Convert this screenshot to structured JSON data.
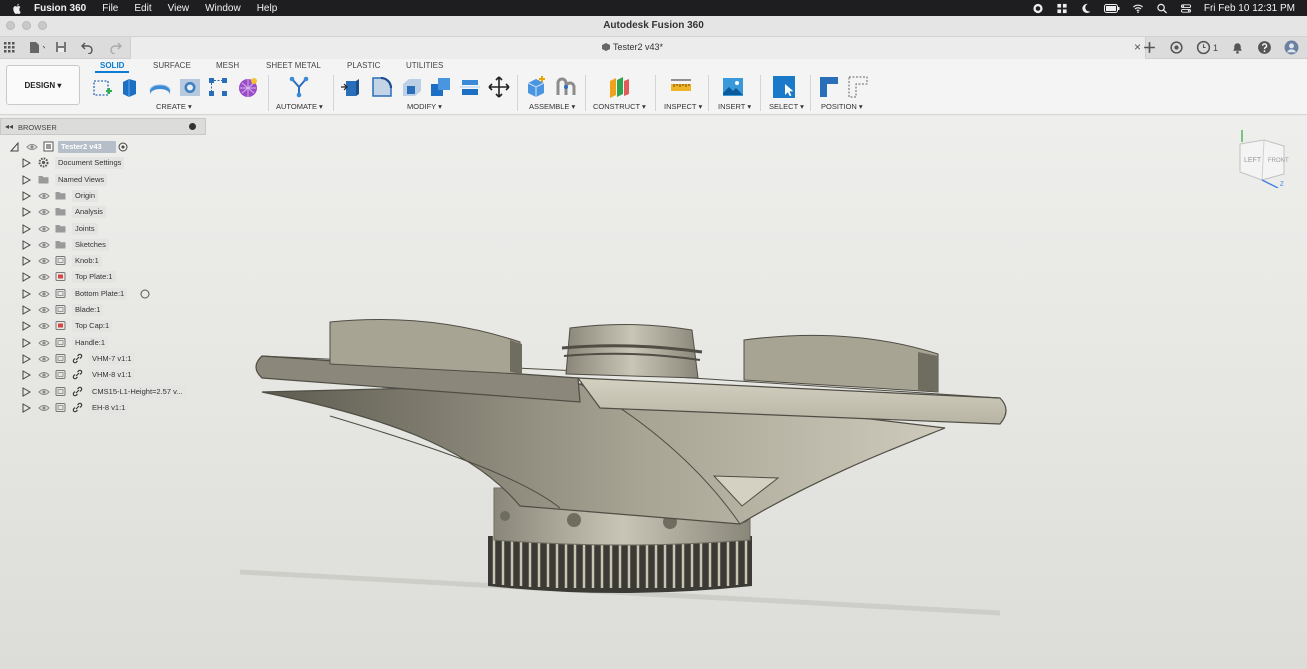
{
  "menubar": {
    "app_name": "Fusion 360",
    "items": [
      "File",
      "Edit",
      "View",
      "Window",
      "Help"
    ],
    "clock": "Fri Feb 10  12:31 PM"
  },
  "window": {
    "title": "Autodesk Fusion 360"
  },
  "document": {
    "tab_title": "Tester2 v43*",
    "close_glyph": "×",
    "job_count": "1"
  },
  "toolbar": {
    "workspace": "DESIGN ▾",
    "tabs": [
      {
        "label": "SOLID",
        "active": true
      },
      {
        "label": "SURFACE",
        "active": false
      },
      {
        "label": "MESH",
        "active": false
      },
      {
        "label": "SHEET METAL",
        "active": false
      },
      {
        "label": "PLASTIC",
        "active": false
      },
      {
        "label": "UTILITIES",
        "active": false
      }
    ],
    "groups": [
      "CREATE ▾",
      "AUTOMATE ▾",
      "MODIFY ▾",
      "ASSEMBLE ▾",
      "CONSTRUCT ▾",
      "INSPECT ▾",
      "INSERT ▾",
      "SELECT ▾",
      "POSITION ▾"
    ],
    "accent_color": "#0a7cd1"
  },
  "browser": {
    "title": "BROWSER",
    "collapse_glyph": "◂◂",
    "root": "Tester2 v43",
    "items": [
      {
        "label": "Document Settings",
        "icon": "gear-icon"
      },
      {
        "label": "Named Views",
        "icon": "folder-icon"
      },
      {
        "label": "Origin",
        "icon": "folder-icon"
      },
      {
        "label": "Analysis",
        "icon": "folder-icon"
      },
      {
        "label": "Joints",
        "icon": "folder-icon"
      },
      {
        "label": "Sketches",
        "icon": "folder-icon"
      },
      {
        "label": "Knob:1",
        "icon": "component-icon"
      },
      {
        "label": "Top Plate:1",
        "icon": "component-red-icon"
      },
      {
        "label": "Bottom Plate:1",
        "icon": "component-icon"
      },
      {
        "label": "Blade:1",
        "icon": "component-icon"
      },
      {
        "label": "Top Cap:1",
        "icon": "component-red-icon"
      },
      {
        "label": "Handle:1",
        "icon": "component-icon"
      },
      {
        "label": "VHM-7 v1:1",
        "icon": "link-icon"
      },
      {
        "label": "VHM-8 v1:1",
        "icon": "link-icon"
      },
      {
        "label": "CMS15-L1-Height=2.57 v...",
        "icon": "link-icon"
      },
      {
        "label": "EH-8 v1:1",
        "icon": "link-icon"
      }
    ]
  },
  "viewcube": {
    "left": "LEFT",
    "front": "FRONT",
    "axis_z": "Z",
    "axis_y": "Y"
  }
}
